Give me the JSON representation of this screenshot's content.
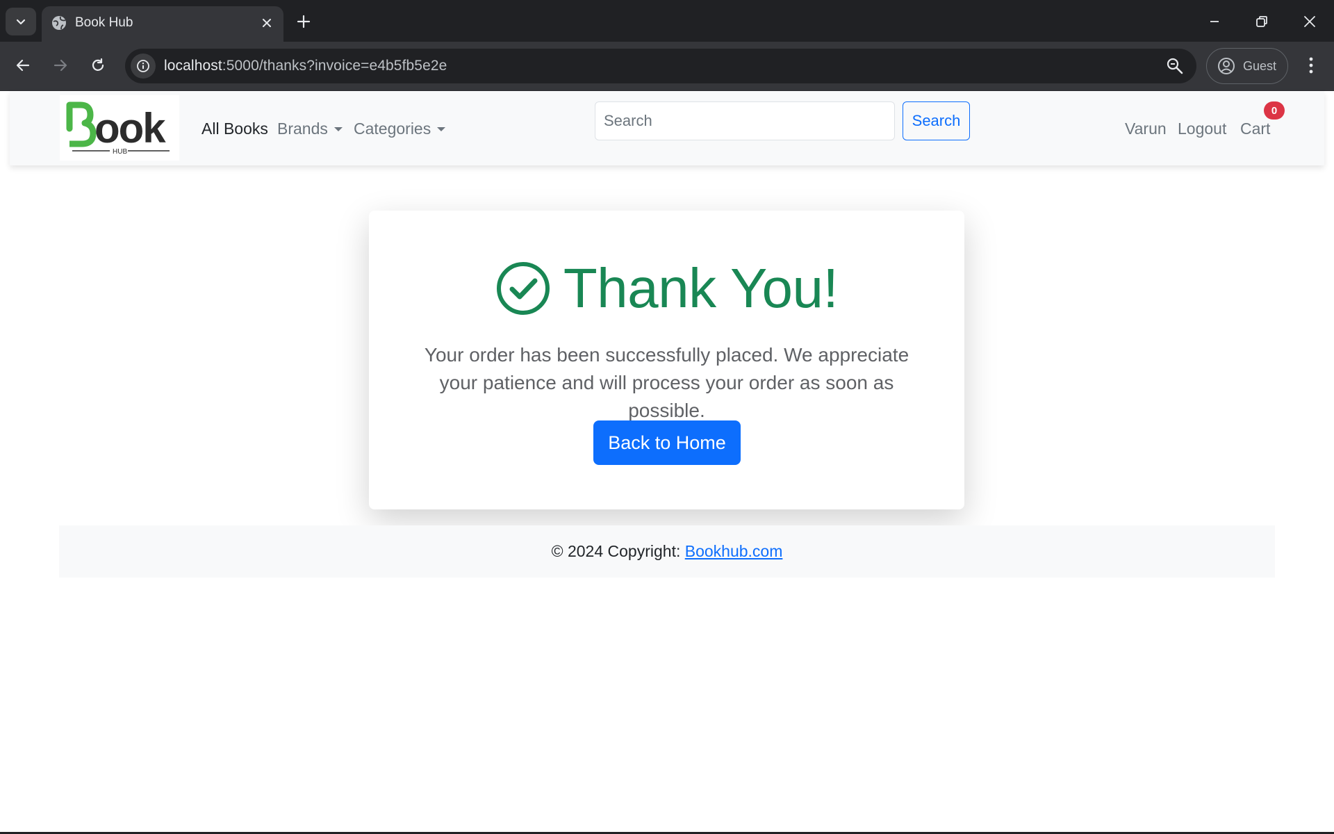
{
  "browser": {
    "tab_title": "Book Hub",
    "url_host": "localhost",
    "url_path": ":5000/thanks?invoice=e4b5fb5e2e",
    "profile_label": "Guest",
    "icons": [
      "tab-list-icon",
      "globe-icon",
      "close-icon",
      "plus-icon",
      "minimize-icon",
      "restore-icon",
      "back-arrow-icon",
      "forward-arrow-icon",
      "reload-icon",
      "info-icon",
      "zoom-icon",
      "profile-icon",
      "more-vert-icon"
    ]
  },
  "navbar": {
    "logo_alt": "Book",
    "logo_sub": "HUB",
    "all_books": "All Books",
    "brands": "Brands",
    "categories": "Categories",
    "search_placeholder": "Search",
    "search_button": "Search",
    "user": "Varun",
    "logout": "Logout",
    "cart": "Cart",
    "cart_count": "0"
  },
  "confirmation": {
    "title": "Thank You!",
    "message": "Your order has been successfully placed. We appreciate your patience and will process your order as soon as possible.",
    "home_button": "Back to Home"
  },
  "footer": {
    "copyright": "© 2024 Copyright: ",
    "link": "Bookhub.com"
  },
  "colors": {
    "success": "#198754",
    "primary": "#0d6efd",
    "danger": "#dc3545",
    "logo_green": "#4cb648",
    "logo_dark": "#2c2c2c"
  }
}
